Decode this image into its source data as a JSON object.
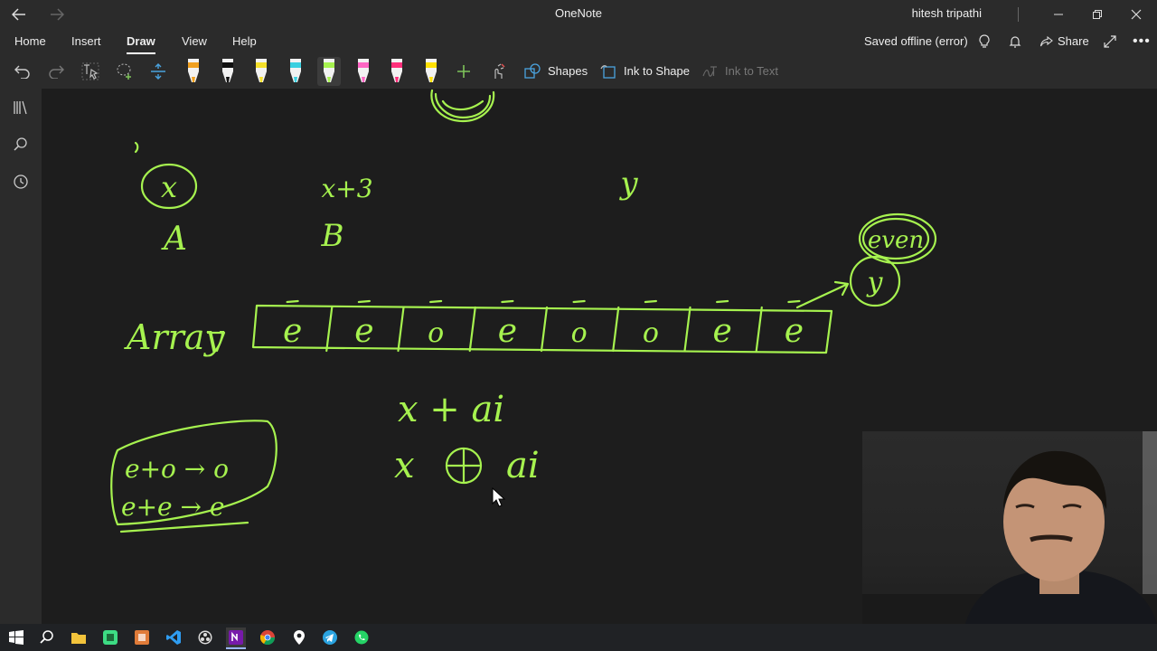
{
  "window": {
    "title": "OneNote",
    "user": "hitesh tripathi",
    "back_icon": "back-arrow-icon",
    "forward_icon": "forward-arrow-icon",
    "controls": [
      "minimize-icon",
      "restore-icon",
      "close-icon"
    ]
  },
  "menu": {
    "tabs": [
      {
        "label": "Home"
      },
      {
        "label": "Insert"
      },
      {
        "label": "Draw"
      },
      {
        "label": "View"
      },
      {
        "label": "Help"
      }
    ],
    "active_tab": "Draw",
    "status": "Saved offline (error)",
    "share_label": "Share"
  },
  "ribbon": {
    "shapes_label": "Shapes",
    "ink_to_shape_label": "Ink to Shape",
    "ink_to_text_label": "Ink to Text",
    "pens": [
      {
        "name": "pen-multicolor-icon",
        "color": "#f0a020"
      },
      {
        "name": "pen-black-icon",
        "color": "#111111"
      },
      {
        "name": "pen-yellow-icon",
        "color": "#f5e02a"
      },
      {
        "name": "pen-cyan-icon",
        "color": "#3ad0e0"
      },
      {
        "name": "highlighter-green-icon",
        "color": "#a6f24f"
      },
      {
        "name": "pen-pink-icon",
        "color": "#ff66c4"
      },
      {
        "name": "pen-magenta-icon",
        "color": "#ff2e7a"
      },
      {
        "name": "highlighter-yellow-icon",
        "color": "#ffe000"
      }
    ]
  },
  "canvas": {
    "ink_color": "#a6f24f",
    "notes": {
      "circle_x": "x",
      "label_a": "A",
      "x_plus_3": "x+3",
      "label_b": "B",
      "y": "y",
      "even": "even",
      "y_circle": "y",
      "array_label": "Array",
      "array_cells": [
        "e",
        "e",
        "o",
        "e",
        "o",
        "o",
        "e",
        "e"
      ],
      "expr1": "x + ai",
      "expr2_left": "x",
      "expr2_right": "ai",
      "rule1": "e+o → o",
      "rule2": "e+e → e"
    }
  },
  "taskbar": {
    "icons": [
      "windows-start-icon",
      "search-icon",
      "file-explorer-icon",
      "app-green-icon",
      "app-orange-icon",
      "vscode-icon",
      "obs-icon",
      "onenote-icon",
      "chrome-icon",
      "maps-icon",
      "telegram-icon",
      "whatsapp-icon"
    ]
  }
}
